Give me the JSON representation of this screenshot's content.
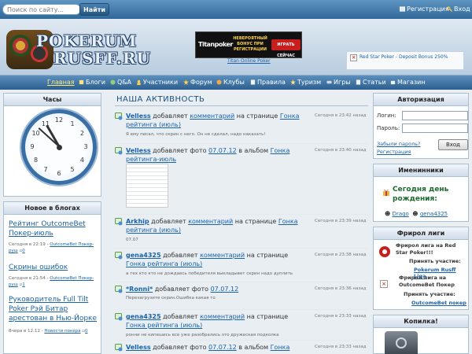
{
  "topbar": {
    "search_placeholder": "Поиск по сайту...",
    "search_button": "Найти",
    "register_link": "Регистрация",
    "login_link": "Вход"
  },
  "header": {
    "logo_line1": "POKERUM",
    "logo_line2": "RUSFF.RU",
    "banner_brand": "Titanpoker",
    "banner_offer": "НЕВЕРОЯТНЫЙ БОНУС ПРИ РЕГИСТРАЦИИ",
    "banner_cta": "ИГРАТЬ СЕЙЧАС",
    "banner_caption": "Titan Online Poker",
    "ad_right_text": "Red Star Poker - Deposit Bonus 250%"
  },
  "nav": {
    "items": [
      {
        "label": "Главная",
        "icon": "home-icon"
      },
      {
        "label": "Блоги",
        "icon": "book-icon"
      },
      {
        "label": "Q&A",
        "icon": "question-icon"
      },
      {
        "label": "Участники",
        "icon": "users-icon"
      },
      {
        "label": "Форум",
        "icon": "forum-icon"
      },
      {
        "label": "Клубы",
        "icon": "clubs-icon"
      },
      {
        "label": "Правила",
        "icon": "rules-icon"
      },
      {
        "label": "Туризм",
        "icon": "star-icon"
      },
      {
        "label": "Игры",
        "icon": "games-icon"
      },
      {
        "label": "Статьи",
        "icon": "articles-icon"
      },
      {
        "label": "Магазин",
        "icon": "shop-icon"
      }
    ]
  },
  "left": {
    "clock_title": "Часы",
    "clock_numbers": [
      "12",
      "1",
      "2",
      "3",
      "4",
      "5",
      "6",
      "7",
      "8",
      "9",
      "10",
      "11"
    ],
    "blogs_title": "Новое в блогах",
    "blogs": [
      {
        "title": "Рейтинг OutcomeBet Покер-июль",
        "time": "Сегодня в 22:19 - ",
        "tag": "OutcomeBet Покер-руш",
        "count": "0"
      },
      {
        "title": "Скрины ошибок",
        "time": "Сегодня в 21:54 - ",
        "tag": "OutcomeBet Покер-руш",
        "count": "1"
      },
      {
        "title": "Руководитель Full Tilt Poker Рэй Битар арестован в Нью-Йорке",
        "time": "Вчера в 12:12 - ",
        "tag": "Новости покера",
        "count": "0"
      }
    ]
  },
  "activity": {
    "title": "НАША АКТИВНОСТЬ",
    "items": [
      {
        "user": "Velless",
        "verb": "добавляет",
        "link1": "комментарий",
        "mid": "на странице",
        "link2": "Гонка рейтинга (июль)",
        "time": "Сегодня в 23:42 назад",
        "text": "Я ему писал, что скрин с него. Он не сделал, надо наказать!"
      },
      {
        "user": "Velless",
        "verb": "добавляет фото",
        "link1": "07.07.12",
        "mid": "в альбом",
        "link2": "Гонка рейтинга-июль",
        "time": "Сегодня в 23:40 назад",
        "text": ""
      },
      {
        "user": "Arkhip",
        "verb": "добавляет",
        "link1": "комментарий",
        "mid": "на странице",
        "link2": "Гонка рейтинга (июль)",
        "time": "Сегодня в 23:39 назад",
        "text": "07.07"
      },
      {
        "user": "gena4325",
        "verb": "добавляет",
        "link1": "комментарий",
        "mid": "на странице",
        "link2": "Гонка рейтинга (июль)",
        "time": "Сегодня в 23:38 назад",
        "text": "а тех кто кто не дождаесь победителя выкладывет скрин надо дуплить"
      },
      {
        "user": "*Ronni*",
        "verb": "добавляет фото",
        "link1": "07.07.12",
        "mid": "",
        "link2": "",
        "time": "Сегодня в 23:36 назад",
        "text": "Перезагрузите скрин.Ошибка какая то"
      },
      {
        "user": "gena4325",
        "verb": "добавляет",
        "link1": "комментарий",
        "mid": "на странице",
        "link2": "Гонка рейтинга (июль)",
        "time": "Сегодня в 23:33 назад",
        "text": "ронни не кипешись все уже разобрались это дружеская подколка"
      },
      {
        "user": "Velless",
        "verb": "добавляет фото",
        "link1": "07.07.12",
        "mid": "в альбом",
        "link2": "Гонка",
        "time": "Сегодня в 23:33 назад",
        "text": ""
      }
    ]
  },
  "right": {
    "auth_title": "Авторизация",
    "login_label": "Логин:",
    "password_label": "Пароль:",
    "forgot_link": "Забыли пароль?",
    "register_link": "Регистрация",
    "submit": "Вход",
    "birthday_title": "Именинники",
    "birthday_heading": "Сегодня день рождения:",
    "birthday_users": [
      "Drago",
      "gena4325"
    ],
    "freeroll_title": "Фрирол лиги",
    "freeroll_1_title": "Фрирол лига на Red Star Poker!!!",
    "freeroll_1_sub": "Принять участие:",
    "freeroll_1_link": "Pokerum Rusff Liga",
    "freeroll_2_title": "Фрирол лига на OutcomeBet Покер",
    "freeroll_2_sub": "Принять участие:",
    "freeroll_2_link": "OutcomeBet покер",
    "piggy_title": "Копилка!"
  }
}
